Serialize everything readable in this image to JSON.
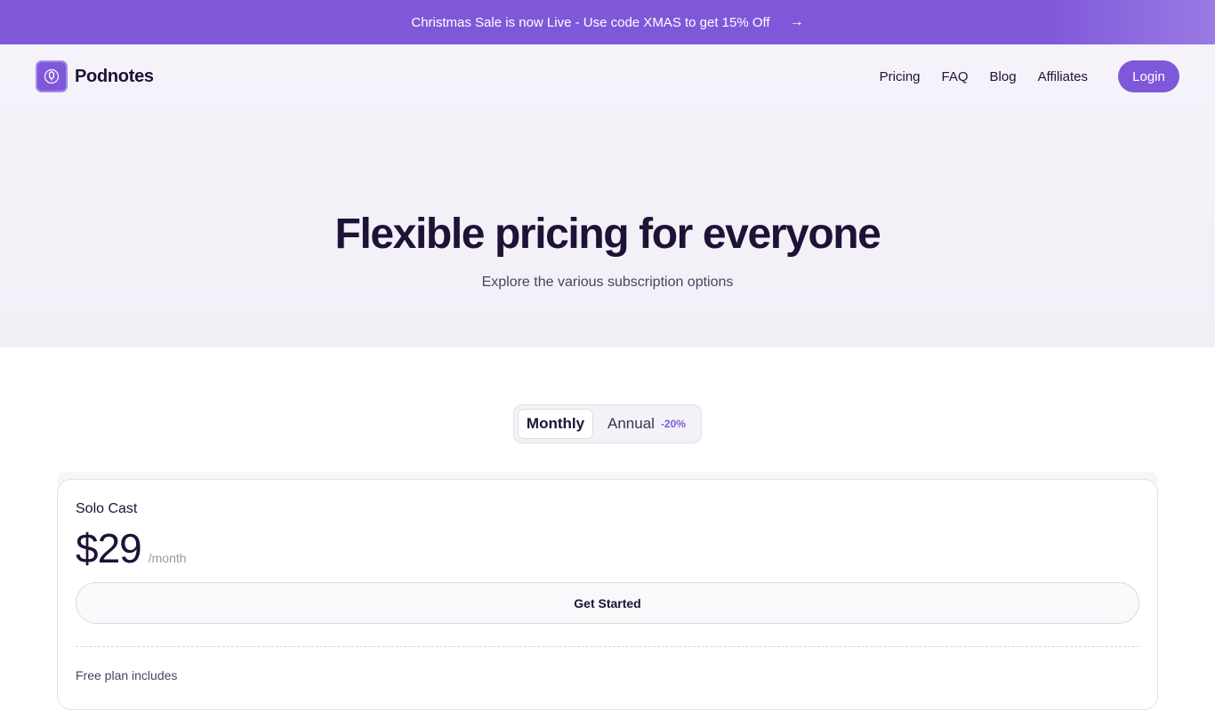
{
  "promo_banner": {
    "text": "Christmas Sale is now Live - Use code XMAS to get 15% Off",
    "arrow": "→"
  },
  "header": {
    "brand": "Podnotes",
    "logo_icon": "microphone-icon",
    "nav": [
      "Pricing",
      "FAQ",
      "Blog",
      "Affiliates"
    ],
    "login_label": "Login"
  },
  "hero": {
    "title": "Flexible pricing for everyone",
    "subtitle": "Explore the various subscription options"
  },
  "billing_toggle": {
    "monthly_label": "Monthly",
    "annual_label": "Annual",
    "annual_discount": "-20%",
    "selected": "Monthly"
  },
  "plans": [
    {
      "name": "Solo Cast",
      "price": "$29",
      "period": "/month",
      "cta_label": "Get Started",
      "includes_heading": "Free plan includes"
    }
  ],
  "colors": {
    "accent": "#7f58da",
    "text_dark": "#1e1236",
    "hero_bg": "#f3f1f8"
  }
}
